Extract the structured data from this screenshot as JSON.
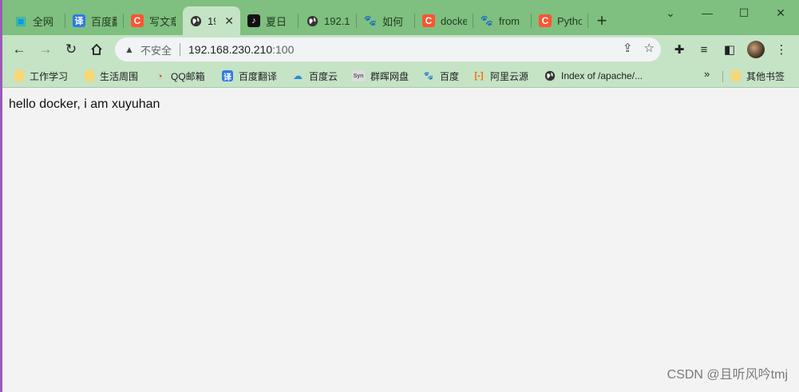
{
  "tabs": [
    {
      "label": "全网",
      "favicon": "bilibili-icon",
      "left": 0
    },
    {
      "label": "百度翻",
      "favicon": "translate-icon"
    },
    {
      "label": "写文章",
      "favicon": "csdn-icon"
    },
    {
      "label": "19",
      "favicon": "globe-icon",
      "active": true
    },
    {
      "label": "夏日",
      "favicon": "tiktok-icon"
    },
    {
      "label": "192.1",
      "favicon": "globe-icon"
    },
    {
      "label": "如何",
      "favicon": "baidu-icon"
    },
    {
      "label": "docke",
      "favicon": "csdn-icon"
    },
    {
      "label": "from",
      "favicon": "baidu-icon"
    },
    {
      "label": "Pytho",
      "favicon": "csdn-icon"
    }
  ],
  "omnibox": {
    "security_label": "不安全",
    "url_host": "192.168.230.210",
    "url_port": ":100"
  },
  "bookmarks": [
    {
      "label": "工作学习",
      "icon": "folder-icon"
    },
    {
      "label": "生活周围",
      "icon": "folder-icon"
    },
    {
      "label": "QQ邮箱",
      "icon": "qqmail-icon"
    },
    {
      "label": "百度翻译",
      "icon": "translate-icon"
    },
    {
      "label": "百度云",
      "icon": "baidu-cloud-icon"
    },
    {
      "label": "群晖网盘",
      "icon": "synology-icon"
    },
    {
      "label": "百度",
      "icon": "baidu-icon"
    },
    {
      "label": "阿里云源",
      "icon": "aliyun-icon"
    },
    {
      "label": "Index of /apache/...",
      "icon": "globe-icon"
    }
  ],
  "other_bookmarks": "其他书签",
  "page": {
    "text": "hello docker, i am xuyuhan"
  },
  "watermark": "CSDN @且听风吟tmj",
  "colors": {
    "tab_strip": "#7fbf7f",
    "toolbar": "#c5e3c5",
    "page_background": "#f3f3f3"
  }
}
